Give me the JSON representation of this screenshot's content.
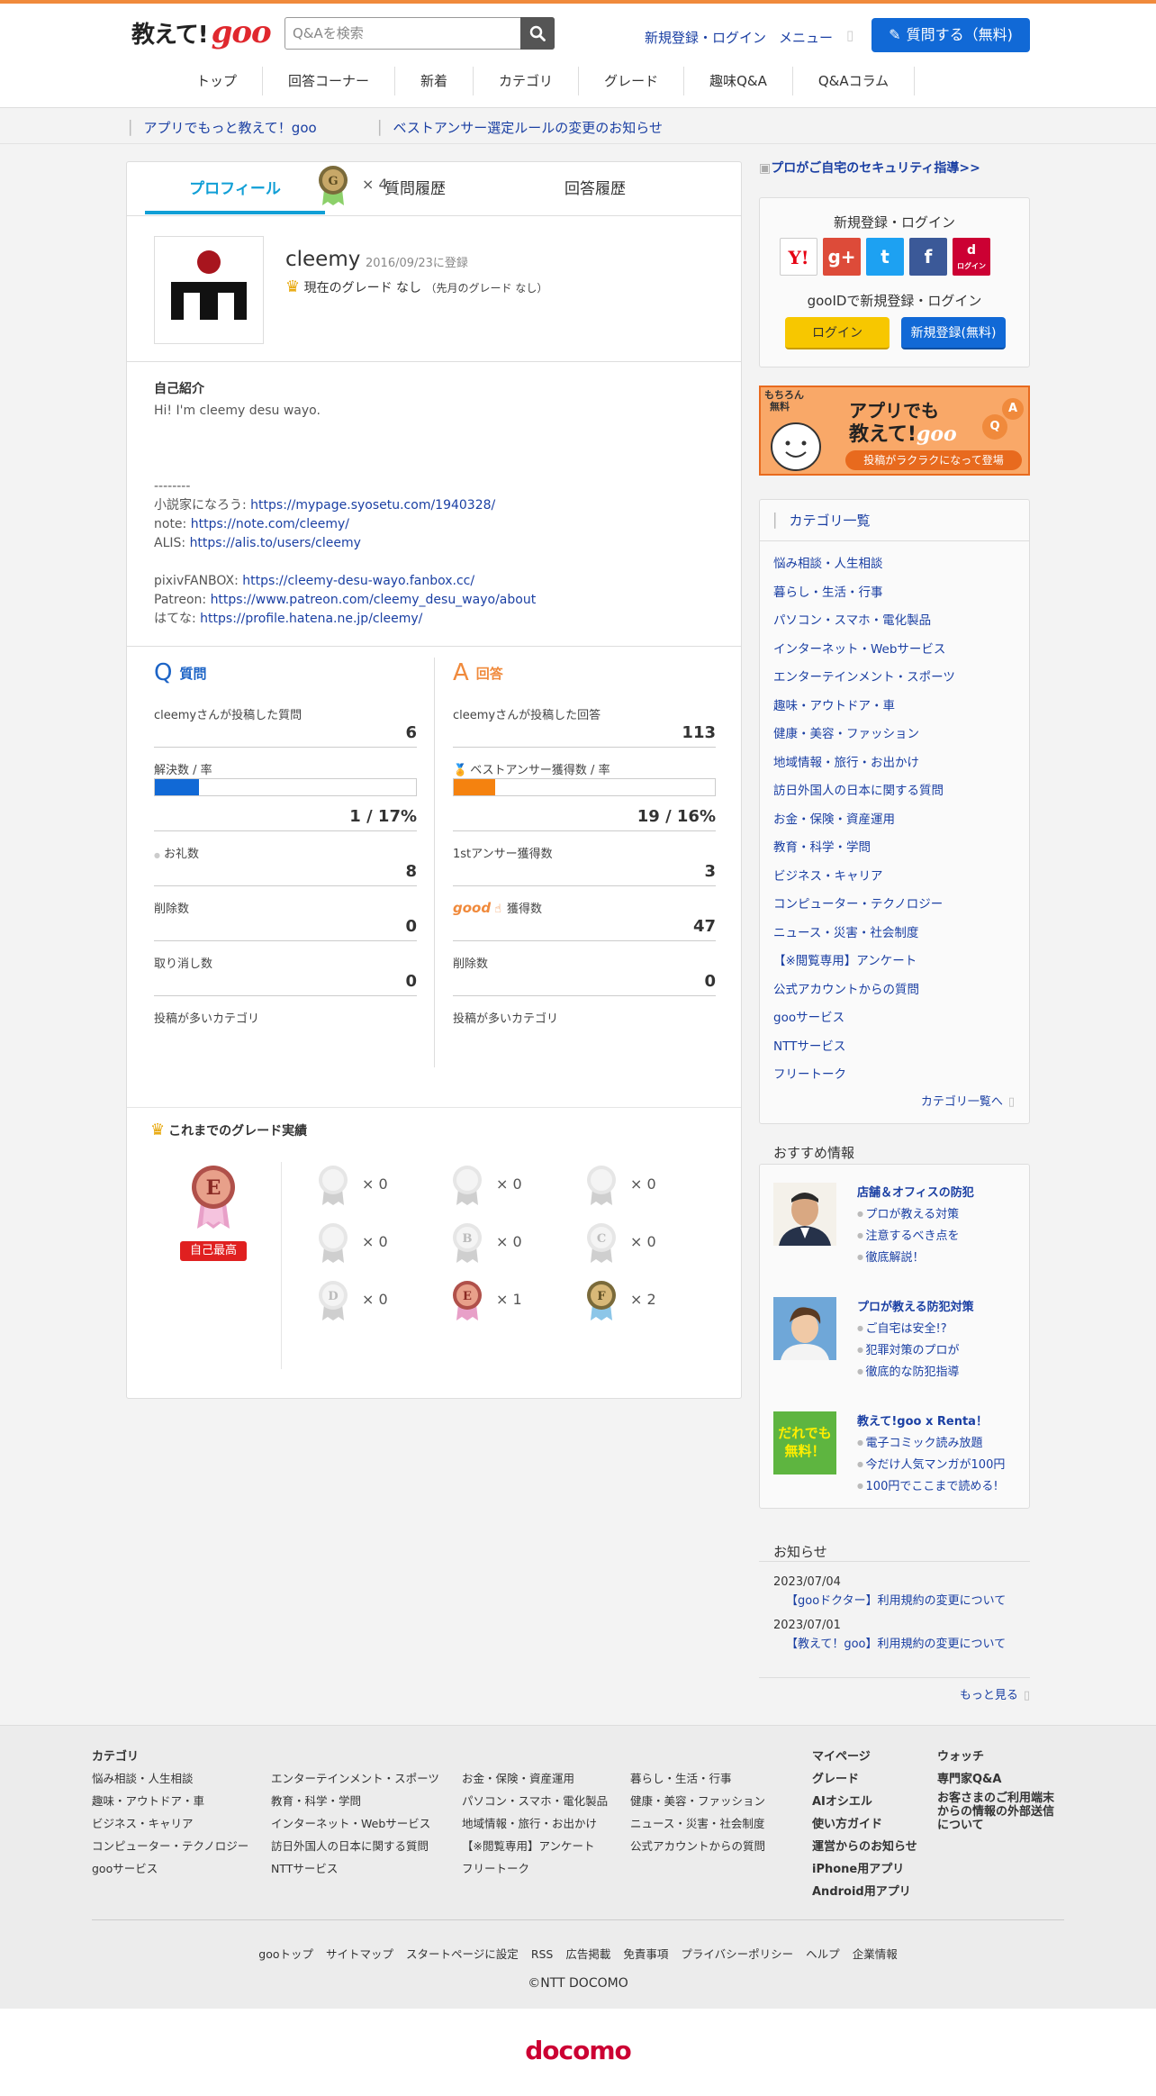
{
  "header": {
    "logo_text": "教えて!",
    "logo_goo": "goo",
    "search_placeholder": "Q&Aを検索",
    "login_link": "新規登録・ログイン",
    "menu_link": "メニュー",
    "ask_button": "質問する（無料)",
    "nav": [
      "トップ",
      "回答コーナー",
      "新着",
      "カテゴリ",
      "グレード",
      "趣味Q&A",
      "Q&Aコラム"
    ]
  },
  "notices": [
    "アプリでもっと教えて！goo",
    "ベストアンサー選定ルールの変更のお知らせ"
  ],
  "tabs": [
    "プロフィール",
    "質問履歴",
    "回答履歴"
  ],
  "profile": {
    "username": "cleemy",
    "registered": "2016/09/23に登録",
    "grade_text": "現在のグレード なし",
    "grade_prev": "（先月のグレード なし）",
    "intro_title": "自己紹介",
    "intro_lines": [
      "Hi! I'm cleemy desu wayo.",
      "",
      "",
      "",
      "--------",
      "小説家になろう: https://mypage.syosetu.com/1940328/",
      "note: https://note.com/cleemy/",
      "ALIS: https://alis.to/users/cleemy",
      "",
      "pixivFANBOX: https://cleemy-desu-wayo.fanbox.cc/",
      "Patreon: https://www.patreon.com/cleemy_desu_wayo/about",
      "はてな: https://profile.hatena.ne.jp/cleemy/"
    ],
    "intro_link_prefixes": [
      "小説家になろう: ",
      "note: ",
      "ALIS: ",
      "pixivFANBOX: ",
      "Patreon: ",
      "はてな: "
    ]
  },
  "questions": {
    "icon": "Q",
    "title": "質問",
    "posted_label": "cleemyさんが投稿した質問",
    "posted_value": "6",
    "solved_label": "解決数 / 率",
    "solved_value": "1 / 17%",
    "solved_rate": 0.17,
    "thanks_label": "お礼数",
    "thanks_value": "8",
    "deleted_label": "削除数",
    "deleted_value": "0",
    "cancel_label": "取り消し数",
    "cancel_value": "0",
    "category_label": "投稿が多いカテゴリ"
  },
  "answers": {
    "icon": "A",
    "title": "回答",
    "posted_label": "cleemyさんが投稿した回答",
    "posted_value": "113",
    "best_label": "ベストアンサー獲得数 / 率",
    "best_value": "19 / 16%",
    "best_rate": 0.16,
    "first_label": "1stアンサー獲得数",
    "first_value": "3",
    "good_logo": "good",
    "good_label": "獲得数",
    "good_value": "47",
    "deleted_label": "削除数",
    "deleted_value": "0",
    "category_label": "投稿が多いカテゴリ"
  },
  "grades": {
    "title": "これまでのグレード実績",
    "best_letter": "E",
    "best_badge": "自己最高",
    "cells": [
      {
        "letter": "",
        "count": "× 0"
      },
      {
        "letter": "",
        "count": "× 0"
      },
      {
        "letter": "",
        "count": "× 0"
      },
      {
        "letter": "",
        "count": "× 0"
      },
      {
        "letter": "B",
        "count": "× 0"
      },
      {
        "letter": "C",
        "count": "× 0"
      },
      {
        "letter": "D",
        "count": "× 0"
      },
      {
        "letter": "E",
        "count": "× 1"
      },
      {
        "letter": "F",
        "count": "× 2"
      },
      {
        "letter": "G",
        "count": "× 4"
      }
    ]
  },
  "sidebar": {
    "banner_link": "プロがご自宅のセキュリティ指導>>",
    "login_title": "新規登録・ログイン",
    "gooid_title": "gooIDで新規登録・ログイン",
    "login_button": "ログイン",
    "register_button": "新規登録(無料)",
    "social": [
      "Y!",
      "g+",
      "t",
      "f",
      "d"
    ],
    "docomo_login": "ログイン",
    "app_banner": {
      "tag1": "もちろん",
      "tag2": "無料",
      "line1": "アプリでも",
      "line2": "教えて!",
      "goo": "goo",
      "line3": "投稿がラクラクになって登場"
    },
    "category_head": "カテゴリ一覧",
    "categories": [
      "悩み相談・人生相談",
      "暮らし・生活・行事",
      "パソコン・スマホ・電化製品",
      "インターネット・Webサービス",
      "エンターテインメント・スポーツ",
      "趣味・アウトドア・車",
      "健康・美容・ファッション",
      "地域情報・旅行・お出かけ",
      "訪日外国人の日本に関する質問",
      "お金・保険・資産運用",
      "教育・科学・学問",
      "ビジネス・キャリア",
      "コンピューター・テクノロジー",
      "ニュース・災害・社会制度",
      "【※閲覧専用】アンケート",
      "公式アカウントからの質問",
      "gooサービス",
      "NTTサービス",
      "フリートーク"
    ],
    "category_more": "カテゴリ一覧へ",
    "recommend_title": "おすすめ情報",
    "recommends": [
      {
        "title": "店舗＆オフィスの防犯",
        "items": [
          "プロが教える対策",
          "注意するべき点を",
          "徹底解説！"
        ]
      },
      {
        "title": "プロが教える防犯対策",
        "items": [
          "ご自宅は安全!?",
          "犯罪対策のプロが",
          "徹底的な防犯指導"
        ]
      },
      {
        "title": "教えて!goo x Renta！",
        "items": [
          "電子コミック読み放題",
          "今だけ人気マンガが100円",
          "100円でここまで読める!"
        ],
        "img_text1": "だれでも",
        "img_text2": "無料！"
      }
    ],
    "news_title": "お知らせ",
    "news": [
      {
        "date": "2023/07/04",
        "text": "【gooドクター】利用規約の変更について"
      },
      {
        "date": "2023/07/01",
        "text": "【教えて！goo】利用規約の変更について"
      }
    ],
    "news_more": "もっと見る"
  },
  "footer": {
    "category_head": "カテゴリ",
    "col1": [
      "悩み相談・人生相談",
      "趣味・アウトドア・車",
      "ビジネス・キャリア",
      "コンピューター・テクノロジー",
      "gooサービス"
    ],
    "col2": [
      "エンターテインメント・スポーツ",
      "教育・科学・学問",
      "インターネット・Webサービス",
      "訪日外国人の日本に関する質問",
      "NTTサービス"
    ],
    "col3": [
      "お金・保険・資産運用",
      "パソコン・スマホ・電化製品",
      "地域情報・旅行・お出かけ",
      "【※閲覧専用】アンケート",
      "フリートーク"
    ],
    "col4": [
      "暮らし・生活・行事",
      "健康・美容・ファッション",
      "ニュース・災害・社会制度",
      "公式アカウントからの質問"
    ],
    "col5": [
      "マイページ",
      "グレード",
      "AIオシエル",
      "使い方ガイド",
      "運営からのお知らせ",
      "iPhone用アプリ",
      "Android用アプリ"
    ],
    "col6": [
      "ウォッチ",
      "専門家Q&A",
      "お客さまのご利用端末からの情報の外部送信について"
    ],
    "links": [
      "gooトップ",
      "サイトマップ",
      "スタートページに設定",
      "RSS",
      "広告掲載",
      "免責事項",
      "プライバシーポリシー",
      "ヘルプ",
      "企業情報"
    ],
    "copyright": "©NTT DOCOMO",
    "docomo": "docomo"
  },
  "colors": {
    "accent_blue": "#1169d6",
    "accent_orange": "#f08a3c",
    "tab_active": "#119fd6",
    "link": "#1a3fa3",
    "badge_red": "#e02020"
  }
}
